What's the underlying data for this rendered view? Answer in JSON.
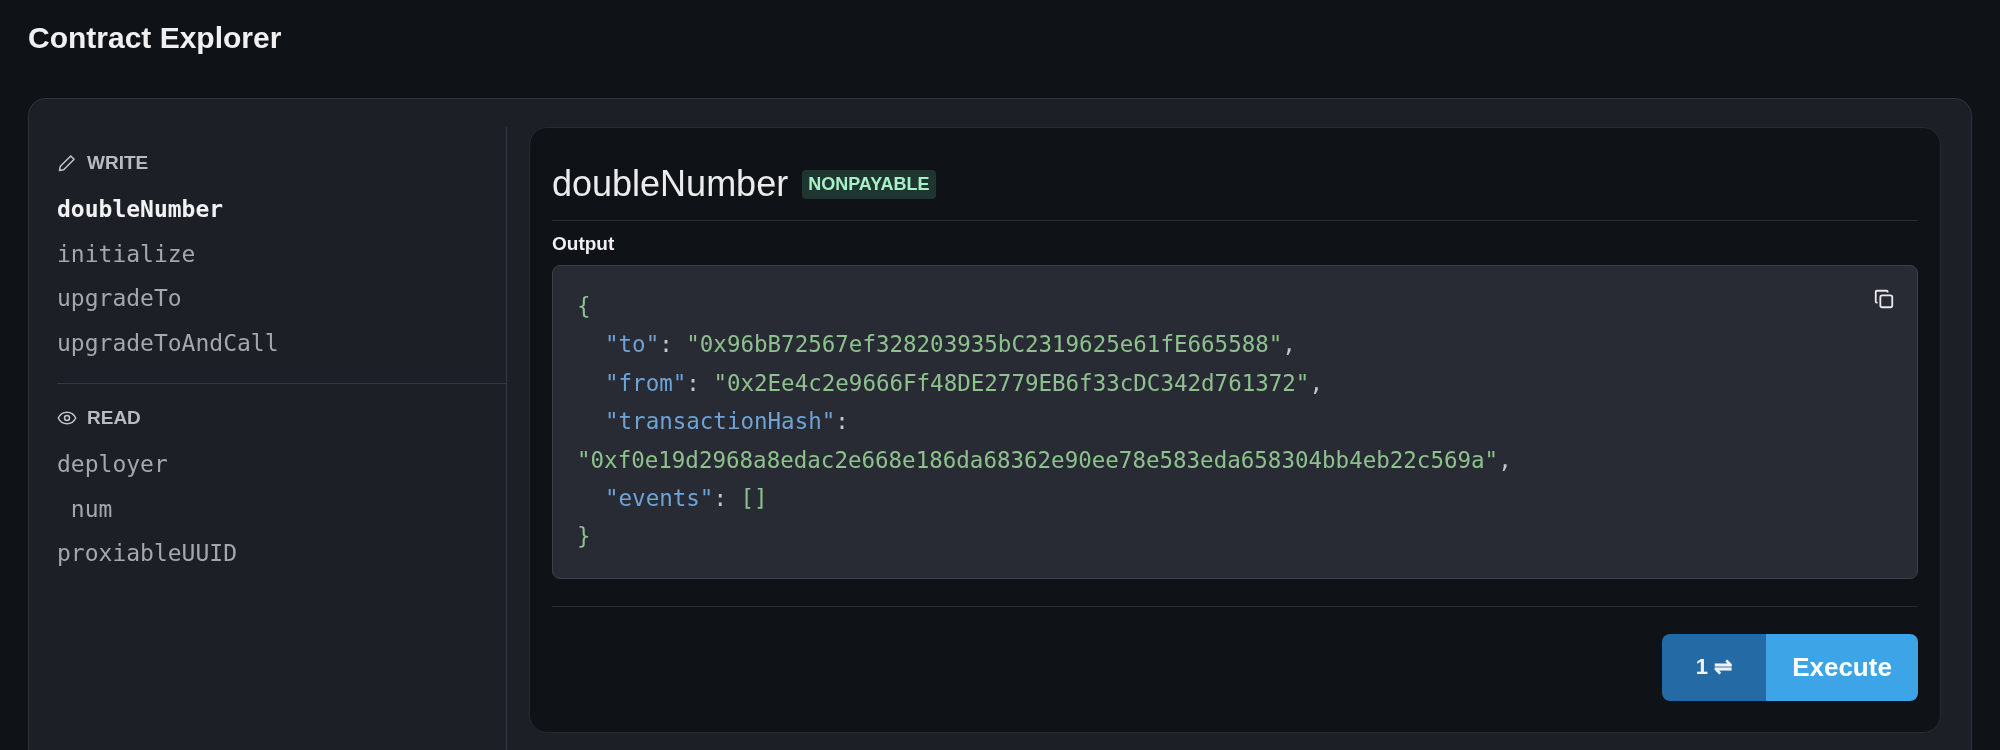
{
  "page": {
    "title": "Contract Explorer"
  },
  "sidebar": {
    "sections": [
      {
        "kind": "write",
        "label": "WRITE",
        "items": [
          {
            "label": "doubleNumber",
            "selected": true
          },
          {
            "label": "initialize",
            "selected": false
          },
          {
            "label": "upgradeTo",
            "selected": false
          },
          {
            "label": "upgradeToAndCall",
            "selected": false
          }
        ]
      },
      {
        "kind": "read",
        "label": "READ",
        "items": [
          {
            "label": "deployer",
            "selected": false
          },
          {
            "label": " num",
            "selected": false
          },
          {
            "label": "proxiableUUID",
            "selected": false
          }
        ]
      }
    ]
  },
  "function_panel": {
    "name": "doubleNumber",
    "badge": "NONPAYABLE",
    "output_label": "Output",
    "output_lines": [
      {
        "kind": "top",
        "tokens": [
          {
            "kind": "bracket",
            "text": "{"
          }
        ]
      },
      {
        "kind": "member",
        "tokens": [
          {
            "kind": "key",
            "text": "\"to\""
          },
          {
            "kind": "punct",
            "text": ": "
          },
          {
            "kind": "string",
            "text": "\"0x96bB72567ef328203935bC2319625e61fE665588\""
          },
          {
            "kind": "punct",
            "text": ","
          }
        ]
      },
      {
        "kind": "member",
        "tokens": [
          {
            "kind": "key",
            "text": "\"from\""
          },
          {
            "kind": "punct",
            "text": ": "
          },
          {
            "kind": "string",
            "text": "\"0x2Ee4c2e9666Ff48DE2779EB6f33cDC342d761372\""
          },
          {
            "kind": "punct",
            "text": ","
          }
        ]
      },
      {
        "kind": "member",
        "tokens": [
          {
            "kind": "key",
            "text": "\"transactionHash\""
          },
          {
            "kind": "punct",
            "text": ":"
          }
        ]
      },
      {
        "kind": "top",
        "tokens": [
          {
            "kind": "string",
            "text": "\"0xf0e19d2968a8edac2e668e186da68362e90ee78e583eda658304bb4eb22c569a\""
          },
          {
            "kind": "punct",
            "text": ","
          }
        ]
      },
      {
        "kind": "member",
        "tokens": [
          {
            "kind": "key",
            "text": "\"events\""
          },
          {
            "kind": "punct",
            "text": ": "
          },
          {
            "kind": "bracket",
            "text": "[]"
          }
        ]
      },
      {
        "kind": "top",
        "tokens": [
          {
            "kind": "bracket",
            "text": "}"
          }
        ]
      }
    ],
    "count": "1",
    "swap_symbol": "⇌",
    "execute_label": "Execute"
  }
}
